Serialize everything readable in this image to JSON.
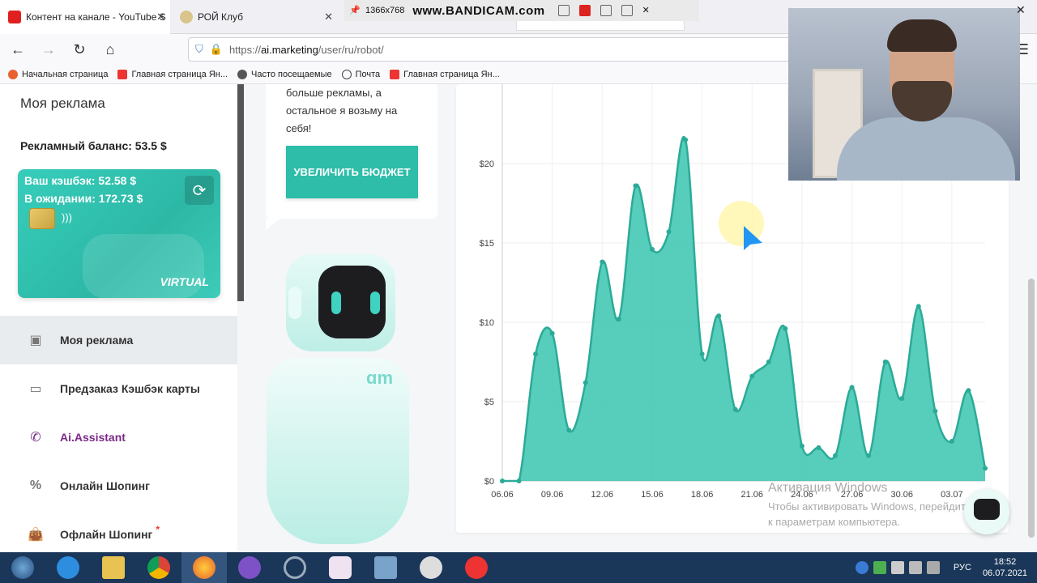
{
  "browser": {
    "tabs": [
      {
        "label": "Контент на канале - YouTube S",
        "active": true
      },
      {
        "label": "РОЙ Клуб",
        "active": false
      }
    ],
    "url": {
      "scheme": "https://",
      "host": "ai.marketing",
      "path": "/user/ru/robot/"
    },
    "bookmarks": [
      {
        "label": "Начальная страница"
      },
      {
        "label": "Главная страница Ян..."
      },
      {
        "label": "Часто посещаемые"
      },
      {
        "label": "Почта"
      },
      {
        "label": "Главная страница Ян..."
      }
    ]
  },
  "recorder": {
    "resolution": "1366x768",
    "brand": "www.BANDICAM.com"
  },
  "sidebar": {
    "title": "Моя реклама",
    "balance": "Рекламный баланс: 53.5 $",
    "card": {
      "cashback": "Ваш кэшбэк: 52.58 $",
      "pending": "В ожидании: 172.73 $",
      "badge": "VIRTUAL"
    },
    "items": [
      {
        "label": "Моя реклама",
        "icon": "badge-icon",
        "active": true
      },
      {
        "label": "Предзаказ Кэшбэк карты",
        "icon": "card-icon"
      },
      {
        "label": "Ai.Assistant",
        "icon": "phone-icon",
        "accent": true
      },
      {
        "label": "Онлайн Шопинг",
        "icon": "discount-icon"
      },
      {
        "label": "Офлайн Шопинг",
        "icon": "bag-icon",
        "star": "*"
      }
    ]
  },
  "promo": {
    "text": "больше рекламы, а остальное я возьму на себя!",
    "button": "УВЕЛИЧИТЬ БЮДЖЕТ",
    "robot_logo": "ɑm"
  },
  "chart_data": {
    "type": "area",
    "title": "",
    "xlabel": "",
    "ylabel": "",
    "color": "#45c8b4",
    "line_color": "#2bab97",
    "ylim": [
      0,
      25
    ],
    "yticks": [
      0,
      5,
      10,
      15,
      20
    ],
    "ytick_labels": [
      "$0",
      "$5",
      "$10",
      "$15",
      "$20"
    ],
    "x": [
      "06.06",
      "07.06",
      "08.06",
      "09.06",
      "10.06",
      "11.06",
      "12.06",
      "13.06",
      "14.06",
      "15.06",
      "16.06",
      "17.06",
      "18.06",
      "19.06",
      "20.06",
      "21.06",
      "22.06",
      "23.06",
      "24.06",
      "25.06",
      "26.06",
      "27.06",
      "28.06",
      "29.06",
      "30.06",
      "01.07",
      "02.07",
      "03.07",
      "04.07"
    ],
    "xtick_labels": [
      "06.06",
      "09.06",
      "12.06",
      "15.06",
      "18.06",
      "21.06",
      "24.06",
      "27.06",
      "30.06",
      "03.07"
    ],
    "values": [
      0,
      0,
      8,
      9.3,
      3.2,
      6.2,
      13.8,
      10.2,
      18.6,
      14.6,
      15.7,
      21.5,
      8.0,
      10.4,
      4.5,
      6.6,
      7.5,
      9.6,
      2.2,
      2.1,
      1.6,
      5.9,
      1.6,
      7.5,
      5.2,
      11.0,
      4.4,
      2.5,
      5.7,
      0.8
    ]
  },
  "windows": {
    "activate_title": "Активация Windows",
    "activate_text": "Чтобы активировать Windows, перейдите к параметрам компьютера.",
    "language": "РУС",
    "time": "18:52",
    "date": "06.07.2021"
  }
}
